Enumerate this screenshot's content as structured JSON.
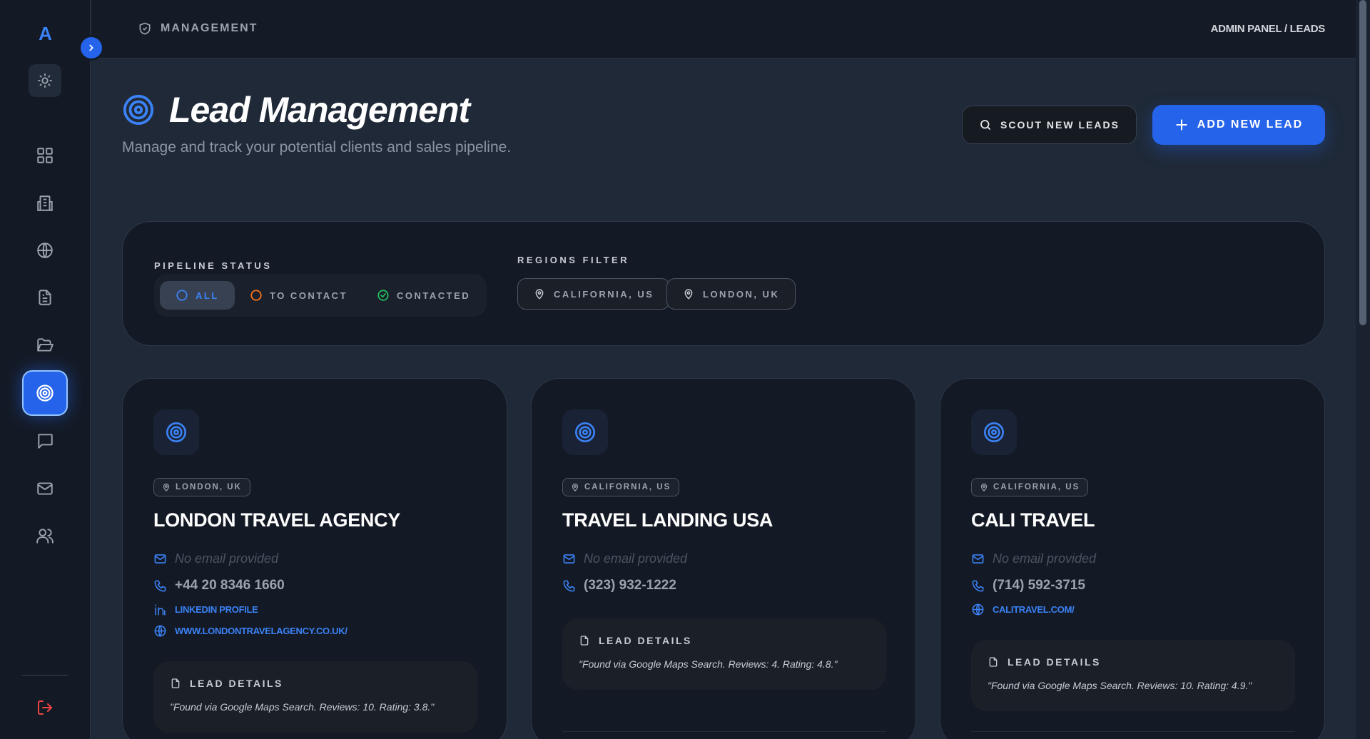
{
  "sidebar": {
    "logo": "A",
    "nav": [
      "dashboard",
      "buildings",
      "globe",
      "documents",
      "folders",
      "leads",
      "chat",
      "mail",
      "users"
    ],
    "active": "leads"
  },
  "topbar": {
    "section": "MANAGEMENT",
    "breadcrumb": "ADMIN PANEL / LEADS"
  },
  "header": {
    "title": "Lead Management",
    "subtitle": "Manage and track your potential clients and sales pipeline.",
    "scout_label": "SCOUT NEW LEADS",
    "add_label": "ADD NEW LEAD"
  },
  "filters": {
    "pipeline_label": "PIPELINE STATUS",
    "statuses": [
      {
        "label": "ALL",
        "active": true,
        "color": "#3b82f6"
      },
      {
        "label": "TO CONTACT",
        "active": false,
        "color": "#f97316"
      },
      {
        "label": "CONTACTED",
        "active": false,
        "color": "#22c55e"
      }
    ],
    "regions_label": "REGIONS FILTER",
    "regions": [
      "CALIFORNIA, US",
      "LONDON, UK"
    ]
  },
  "leads": [
    {
      "location": "LONDON, UK",
      "name": "LONDON TRAVEL AGENCY",
      "email": "No email provided",
      "phone": "+44 20 8346 1660",
      "linkedin": "LINKEDIN PROFILE",
      "website": "WWW.LONDONTRAVELAGENCY.CO.UK/",
      "details_label": "LEAD DETAILS",
      "details": "\"Found via Google Maps Search. Reviews: 10. Rating: 3.8.\""
    },
    {
      "location": "CALIFORNIA, US",
      "name": "TRAVEL LANDING USA",
      "email": "No email provided",
      "phone": "(323) 932-1222",
      "details_label": "LEAD DETAILS",
      "details": "\"Found via Google Maps Search. Reviews: 4. Rating: 4.8.\""
    },
    {
      "location": "CALIFORNIA, US",
      "name": "CALI TRAVEL",
      "email": "No email provided",
      "phone": "(714) 592-3715",
      "website": "CALITRAVEL.COM/",
      "details_label": "LEAD DETAILS",
      "details": "\"Found via Google Maps Search. Reviews: 10. Rating: 4.9.\""
    }
  ],
  "colors": {
    "accent": "#2563eb",
    "background": "#1f2937",
    "panel": "#141a25",
    "danger": "#ef4444"
  }
}
